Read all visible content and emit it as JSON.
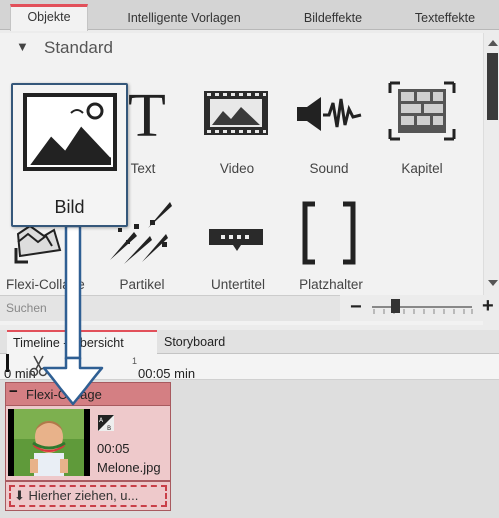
{
  "tabs": [
    "Objekte",
    "Intelligente Vorlagen",
    "Bildeffekte",
    "Texteffekte"
  ],
  "section": {
    "arrow": "▼",
    "title": "Standard"
  },
  "objects_row1": [
    "Text",
    "Video",
    "Sound",
    "Kapitel"
  ],
  "objects_row2": [
    "Flexi-Collage",
    "Partikel",
    "Untertitel",
    "Platzhalter"
  ],
  "drag_card": {
    "label": "Bild",
    "icon": "image-icon"
  },
  "search": {
    "placeholder": "Suchen"
  },
  "zoom": {
    "minus": "−",
    "plus": "+"
  },
  "timeline_tabs": [
    "Timeline - Übersicht",
    "Storyboard"
  ],
  "ruler": {
    "start": "0 min",
    "mark": "00:05 min",
    "tick": "1"
  },
  "track": {
    "title": "Flexi-Collage",
    "collapse": "−",
    "clip_duration": "00:05",
    "clip_file": "Melone.jpg",
    "transition_badge": "AB"
  },
  "dropzone": {
    "label": "Hierher ziehen, u...",
    "arrow": "⬇"
  },
  "colors": {
    "accent": "#e2505a",
    "drag_arrow": "#2f5f93",
    "track": "#d47f83"
  }
}
